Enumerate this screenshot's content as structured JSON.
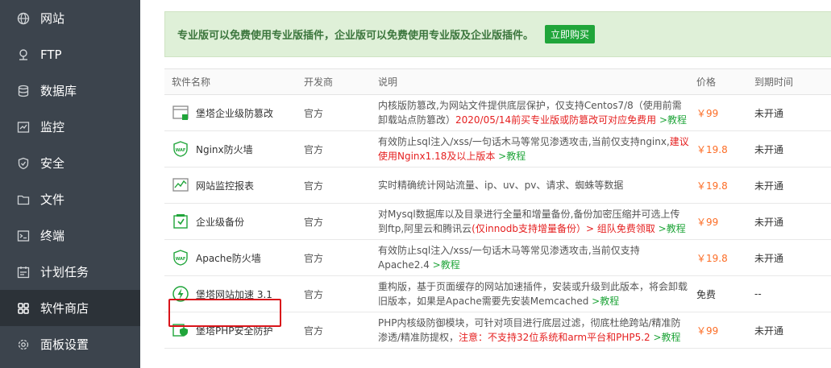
{
  "sidebar": {
    "items": [
      {
        "label": "网站",
        "icon": "globe-icon"
      },
      {
        "label": "FTP",
        "icon": "ftp-icon"
      },
      {
        "label": "数据库",
        "icon": "database-icon"
      },
      {
        "label": "监控",
        "icon": "monitor-icon"
      },
      {
        "label": "安全",
        "icon": "shield-icon"
      },
      {
        "label": "文件",
        "icon": "folder-icon"
      },
      {
        "label": "终端",
        "icon": "terminal-icon"
      },
      {
        "label": "计划任务",
        "icon": "task-icon"
      },
      {
        "label": "软件商店",
        "icon": "apps-icon",
        "active": true
      },
      {
        "label": "面板设置",
        "icon": "gear-icon"
      }
    ]
  },
  "banner": {
    "text": "专业版可以免费使用专业版插件，企业版可以免费使用专业版及企业版插件。",
    "buy_label": "立即购买"
  },
  "table": {
    "headers": {
      "name": "软件名称",
      "developer": "开发商",
      "description": "说明",
      "price": "价格",
      "expire": "到期时间"
    },
    "rows": [
      {
        "name": "堡塔企业级防篡改",
        "icon": "tamper-icon",
        "developer": "官方",
        "desc_a": "内核版防篡改,为网站文件提供底层保护，仅支持Centos7/8（使用前需卸载站点防篡改）",
        "desc_red": "2020/05/14前买专业版或防篡改可对应免费用",
        "desc_link": " >教程",
        "price": "￥99",
        "expire": "未开通"
      },
      {
        "name": "Nginx防火墙",
        "icon": "waf-icon",
        "developer": "官方",
        "desc_a": "有效防止sql注入/xss/一句话木马等常见渗透攻击,当前仅支持nginx,",
        "desc_red": "建议使用Nginx1.18及以上版本",
        "desc_link": " >教程",
        "price": "￥19.8",
        "expire": "未开通"
      },
      {
        "name": "网站监控报表",
        "icon": "chart-icon",
        "developer": "官方",
        "desc_a": "实时精确统计网站流量、ip、uv、pv、请求、蜘蛛等数据",
        "desc_red": "",
        "desc_link": "",
        "price": "￥19.8",
        "expire": "未开通"
      },
      {
        "name": "企业级备份",
        "icon": "backup-icon",
        "developer": "官方",
        "desc_a": "对Mysql数据库以及目录进行全量和增量备份,备份加密压缩并可选上传到ftp,阿里云和腾讯云",
        "desc_red": "(仅innodb支持增量备份）> 组队免费领取",
        "desc_link": " >教程",
        "price": "￥99",
        "expire": "未开通"
      },
      {
        "name": "Apache防火墙",
        "icon": "waf-icon",
        "developer": "官方",
        "desc_a": "有效防止sql注入/xss/一句话木马等常见渗透攻击,当前仅支持Apache2.4",
        "desc_red": "",
        "desc_link": " >教程",
        "price": "￥19.8",
        "expire": "未开通"
      },
      {
        "name": "堡塔网站加速 3.1",
        "icon": "lightning-icon",
        "developer": "官方",
        "desc_a": "重构版，基于页面缓存的网站加速插件，安装或升级到此版本，将会卸载旧版本，如果是Apache需要先安装Memcached",
        "desc_red": "",
        "desc_link": " >教程",
        "price": "免费",
        "free": true,
        "expire": "--"
      },
      {
        "name": "堡塔PHP安全防护",
        "icon": "php-shield-icon",
        "developer": "官方",
        "desc_a": "PHP内核级防御模块，可针对项目进行底层过滤，彻底杜绝跨站/精准防渗透/精准防提权，",
        "desc_red": "注意：不支持32位系统和arm平台和PHP5.2",
        "desc_link": " >教程",
        "price": "￥99",
        "expire": "未开通"
      }
    ]
  }
}
